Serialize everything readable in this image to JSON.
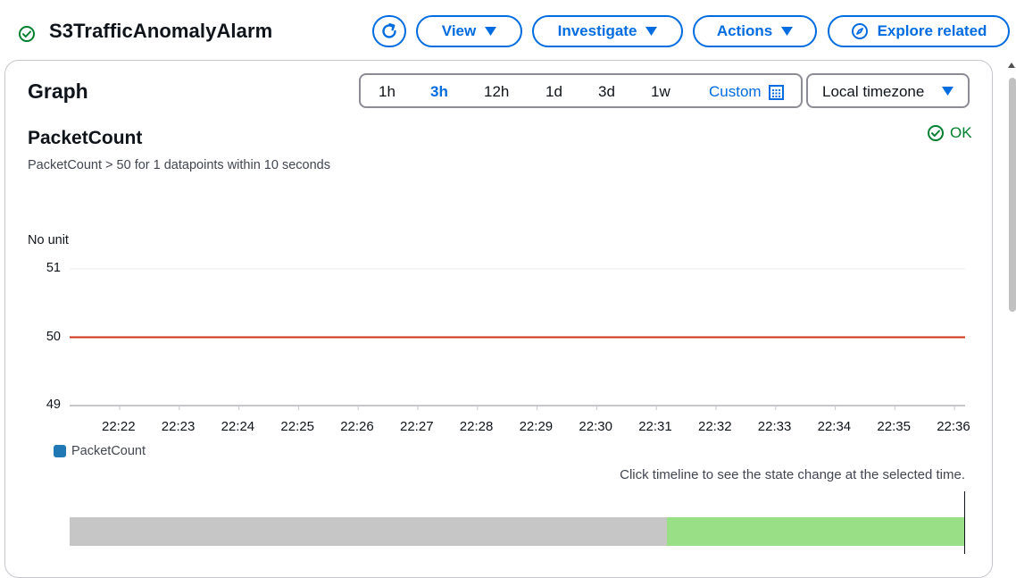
{
  "header": {
    "title": "S3TrafficAnomalyAlarm",
    "status_icon": "check-circle-icon",
    "buttons": {
      "refresh_icon": "refresh-icon",
      "view": "View",
      "investigate": "Investigate",
      "actions": "Actions",
      "explore_related": "Explore related",
      "explore_icon": "compass-icon"
    }
  },
  "graph_panel": {
    "title": "Graph",
    "time_ranges": [
      "1h",
      "3h",
      "12h",
      "1d",
      "3d",
      "1w"
    ],
    "selected_range": "3h",
    "custom_label": "Custom",
    "custom_icon": "calendar-icon",
    "timezone": "Local timezone",
    "metric": {
      "name": "PacketCount",
      "description": "PacketCount > 50 for 1 datapoints within 10 seconds",
      "state": "OK"
    },
    "timeline_hint": "Click timeline to see the state change at the selected time."
  },
  "colors": {
    "accent": "#006ce0",
    "ok": "#00802f",
    "threshold": "#d13212",
    "series": "#1f77b4",
    "timeline_insufficient": "#c6c6c6",
    "timeline_ok": "#98df85"
  },
  "chart_data": {
    "type": "line",
    "ylabel": "No unit",
    "ylim": [
      49,
      51
    ],
    "yticks": [
      51,
      50,
      49
    ],
    "x": [
      "22:22",
      "22:23",
      "22:24",
      "22:25",
      "22:26",
      "22:27",
      "22:28",
      "22:29",
      "22:30",
      "22:31",
      "22:32",
      "22:33",
      "22:34",
      "22:35",
      "22:36"
    ],
    "series": [
      {
        "name": "PacketCount",
        "values": []
      }
    ],
    "threshold": 50,
    "legend": [
      "PacketCount"
    ],
    "grid": true,
    "state_timeline": [
      {
        "state": "insufficient data",
        "start": "22:21",
        "end": "22:31"
      },
      {
        "state": "OK",
        "start": "22:31",
        "end": "22:36"
      }
    ]
  }
}
